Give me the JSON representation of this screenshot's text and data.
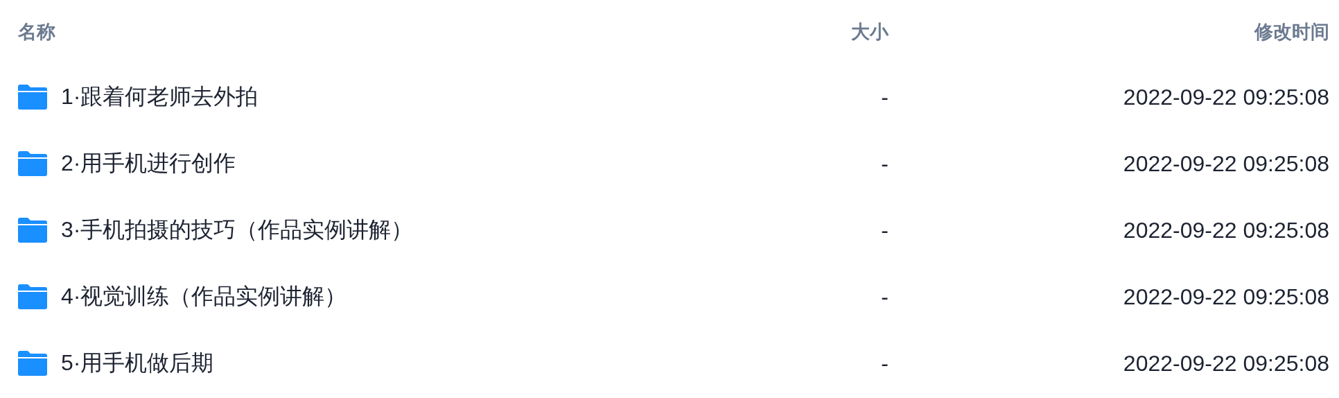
{
  "table": {
    "columns": [
      {
        "label": "名称"
      },
      {
        "label": "大小"
      },
      {
        "label": "修改时间"
      }
    ],
    "rows": [
      {
        "kind": "folder",
        "name": "1·跟着何老师去外拍",
        "size": "-",
        "modified": "2022-09-22 09:25:08"
      },
      {
        "kind": "folder",
        "name": "2·用手机进行创作",
        "size": "-",
        "modified": "2022-09-22 09:25:08"
      },
      {
        "kind": "folder",
        "name": "3·手机拍摄的技巧（作品实例讲解）",
        "size": "-",
        "modified": "2022-09-22 09:25:08"
      },
      {
        "kind": "folder",
        "name": "4·视觉训练（作品实例讲解）",
        "size": "-",
        "modified": "2022-09-22 09:25:08"
      },
      {
        "kind": "folder",
        "name": "5·用手机做后期",
        "size": "-",
        "modified": "2022-09-22 09:25:08"
      }
    ]
  }
}
